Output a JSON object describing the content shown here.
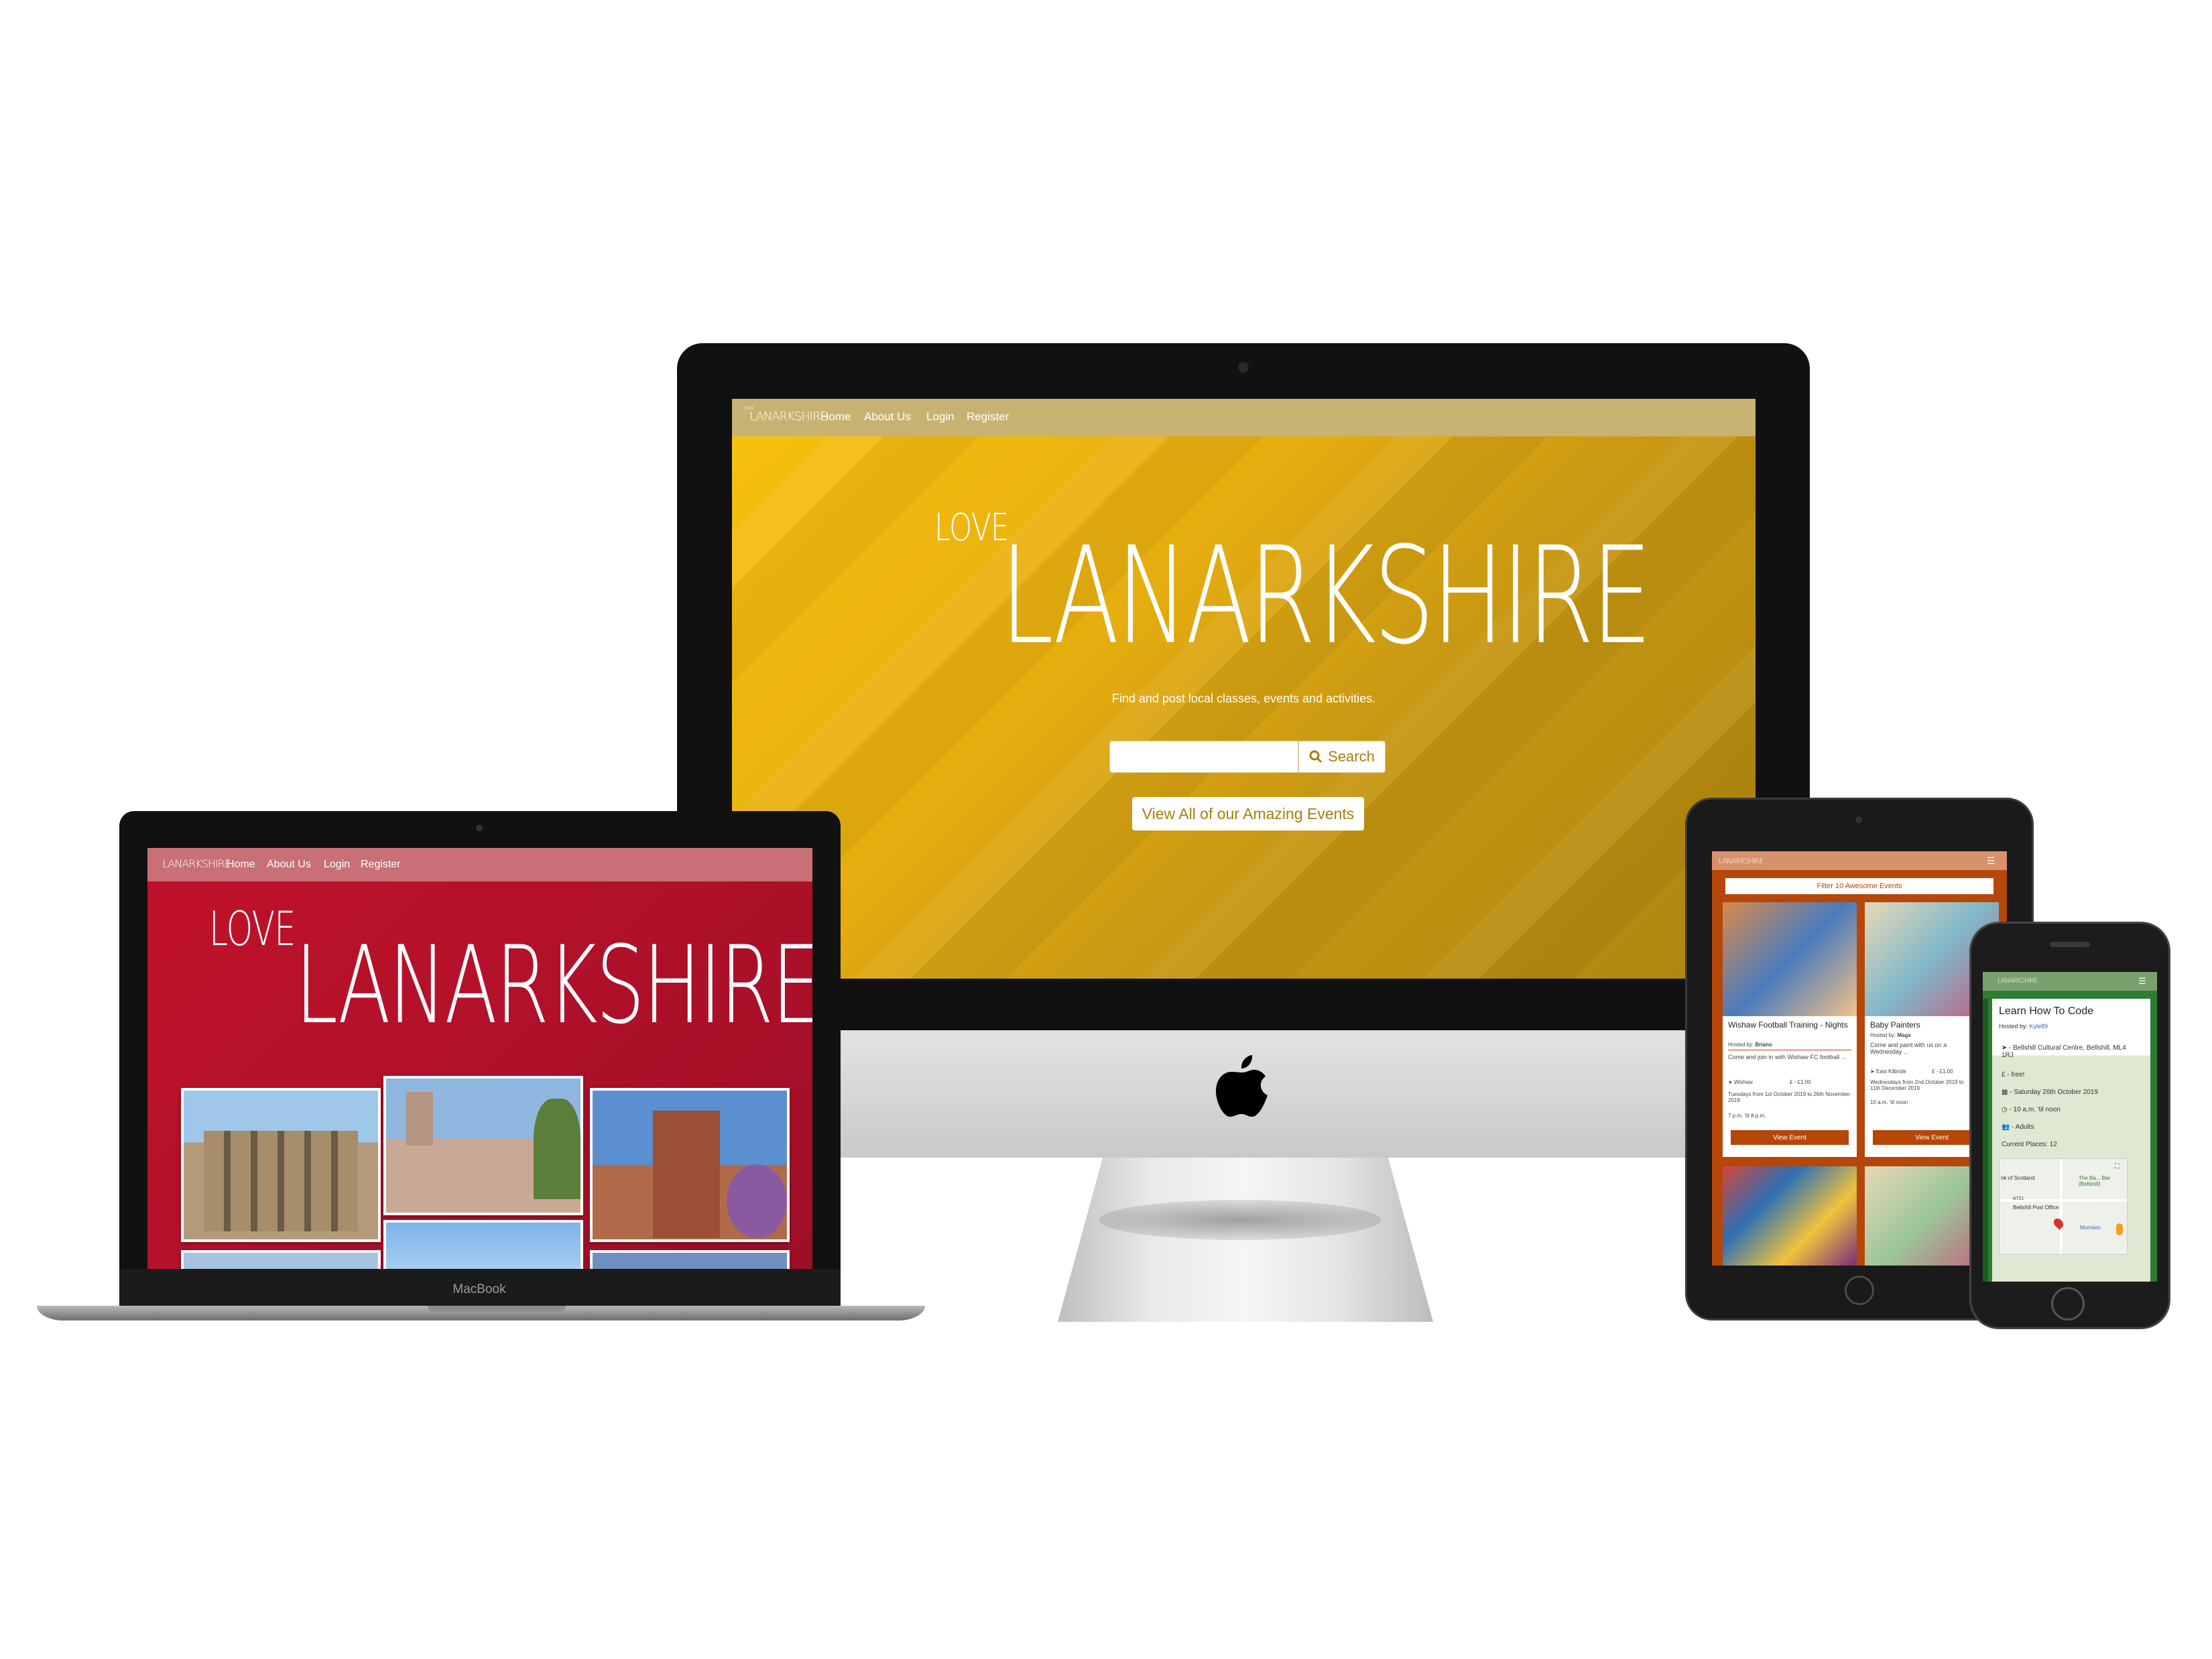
{
  "imac": {
    "nav": {
      "logo_small": "LANARKSHIRE",
      "links": [
        "Home",
        "About Us",
        "Login",
        "Register"
      ]
    },
    "hero": {
      "love": "LOVE",
      "lanarkshire": "LANARKSHIRE"
    },
    "tagline": "Find and post local classes, events and activities.",
    "search": {
      "placeholder": "",
      "button_label": "Search"
    },
    "events_button": "View All of our Amazing Events"
  },
  "macbook": {
    "nav": {
      "logo_small": "LANARKSHIRE",
      "links": [
        "Home",
        "About Us",
        "Login",
        "Register"
      ]
    },
    "hero": {
      "love": "LOVE",
      "lanarkshire": "LANARKSHIRE"
    },
    "label": "MacBook"
  },
  "ipad": {
    "nav": {
      "logo_small": "LANARKSHIRE"
    },
    "filter_button": "Filter 10 Awesome Events",
    "cards": [
      {
        "title": "Wishaw Football Training - Nights",
        "host_prefix": "Hosted by:",
        "host": "Briano",
        "desc": "Come and join in with Wishaw FC football ...",
        "location": "Wishaw",
        "price": "£ - £1.00",
        "dates": "Tuesdays from 1st October 2019 to 26th November 2019",
        "time": "7 p.m. 'til 8 p.m.",
        "button": "View Event"
      },
      {
        "title": "Baby Painters",
        "host_prefix": "Hosted by:",
        "host": "Mags",
        "desc": "Come and paint with us on a Wednesday ...",
        "location": "East Kilbride",
        "price": "£ - £1.00",
        "dates": "Wednesdays from 2nd October 2019 to 11th December 2019",
        "time": "10 a.m. 'til noon",
        "button": "View Event"
      }
    ]
  },
  "iphone": {
    "nav": {
      "logo_small": "LANARKSHIRE"
    },
    "event": {
      "title": "Learn How To Code",
      "host_prefix": "Hosted by:",
      "host": "Kyle89",
      "location": "- Bellshill Cultural Centre, Bellshill, ML4 1RJ",
      "price": "- free!",
      "date": "- Saturday 26th October 2019",
      "time": "- 10 a.m. 'til noon",
      "audience": "- Adults",
      "places": "Current Places: 12"
    },
    "map_labels": [
      "nk of Scotland",
      "The Ba... Bar (Bellshill)",
      "A721",
      "Bellshill Post Office",
      "Morrison"
    ]
  },
  "colors": {
    "imac_accent": "#a87d0b",
    "macbook_accent": "#b3112a",
    "ipad_accent": "#b5470a",
    "iphone_accent": "#2e7d32"
  }
}
